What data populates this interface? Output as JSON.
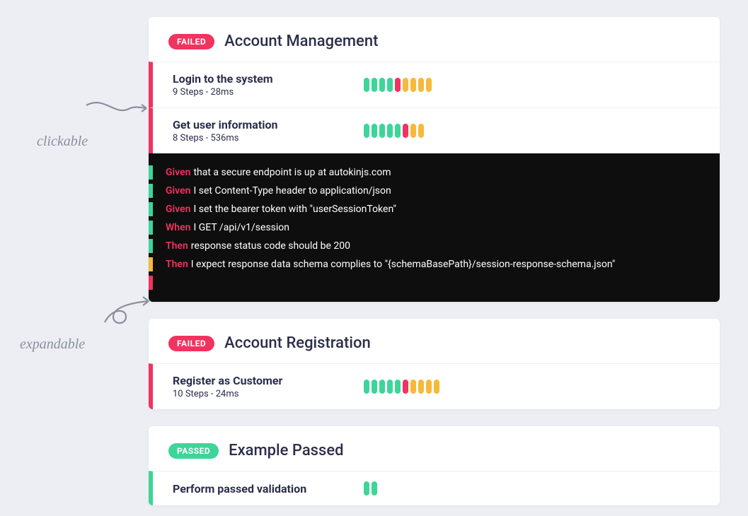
{
  "annotations": {
    "clickable": "clickable",
    "expandable": "expandable"
  },
  "sections": [
    {
      "status": "FAILED",
      "status_kind": "failed",
      "title": "Account Management",
      "scenarios": [
        {
          "name": "Login to the system",
          "meta": "9 Steps - 28ms",
          "border": "fail",
          "pills": [
            "pass",
            "pass",
            "pass",
            "pass",
            "fail",
            "warn",
            "warn",
            "warn",
            "warn"
          ],
          "steps": null
        },
        {
          "name": "Get user information",
          "meta": "8 Steps - 536ms",
          "border": "fail",
          "pills": [
            "pass",
            "pass",
            "pass",
            "pass",
            "pass",
            "fail",
            "warn",
            "warn"
          ],
          "steps": [
            {
              "marker": "pass",
              "keyword": "Given",
              "text": "that a secure endpoint is up at autokinjs.com"
            },
            {
              "marker": "pass",
              "keyword": "Given",
              "text": "I set Content-Type header to application/json"
            },
            {
              "marker": "pass",
              "keyword": "Given",
              "text": "I set the bearer token with \"userSessionToken\""
            },
            {
              "marker": "pass",
              "keyword": "When",
              "text": "I GET /api/v1/session"
            },
            {
              "marker": "pass",
              "keyword": "Then",
              "text": "response status code should be 200"
            },
            {
              "marker": "warn",
              "keyword": "Then",
              "text": "I expect response data schema complies to \"{schemaBasePath}/session-response-schema.json\""
            },
            {
              "marker": "fail",
              "keyword": "",
              "text": ""
            }
          ]
        }
      ]
    },
    {
      "status": "FAILED",
      "status_kind": "failed",
      "title": "Account Registration",
      "scenarios": [
        {
          "name": "Register as Customer",
          "meta": "10 Steps - 24ms",
          "border": "fail",
          "pills": [
            "pass",
            "pass",
            "pass",
            "pass",
            "pass",
            "fail",
            "warn",
            "warn",
            "warn",
            "warn"
          ],
          "steps": null
        }
      ]
    },
    {
      "status": "PASSED",
      "status_kind": "passed",
      "title": "Example Passed",
      "scenarios": [
        {
          "name": "Perform passed validation",
          "meta": "",
          "border": "pass",
          "pills": [
            "pass",
            "pass"
          ],
          "steps": null
        }
      ]
    }
  ]
}
